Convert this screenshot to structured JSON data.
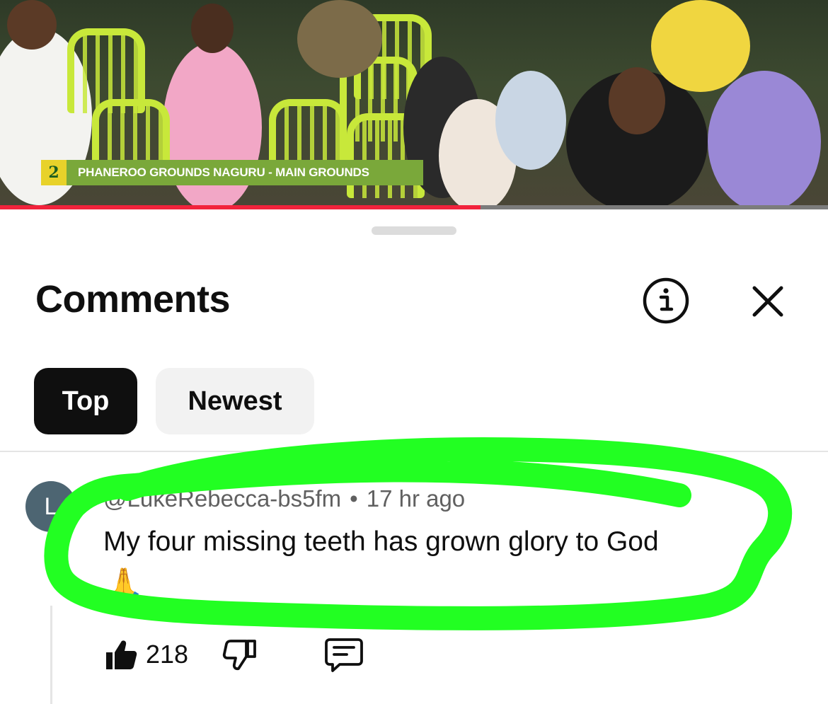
{
  "video": {
    "overlay_caption": "PHANEROO GROUNDS NAGURU - MAIN GROUNDS",
    "logo_text": "2",
    "progress_fraction": 0.58,
    "progress_color": "#f2233c"
  },
  "sheet": {
    "title": "Comments",
    "info_icon": "info-circle-icon",
    "close_icon": "close-icon"
  },
  "filters": {
    "top_label": "Top",
    "newest_label": "Newest",
    "selected": "Top"
  },
  "comment": {
    "avatar_initial": "L",
    "avatar_color": "#4d6572",
    "author": "@LukeRebecca-bs5fm",
    "separator": "•",
    "time": "17 hr ago",
    "text": "My four missing teeth has grown glory to God",
    "emoji": "🙏",
    "likes": "218"
  },
  "annotation": {
    "highlight_color": "#22ff22"
  }
}
